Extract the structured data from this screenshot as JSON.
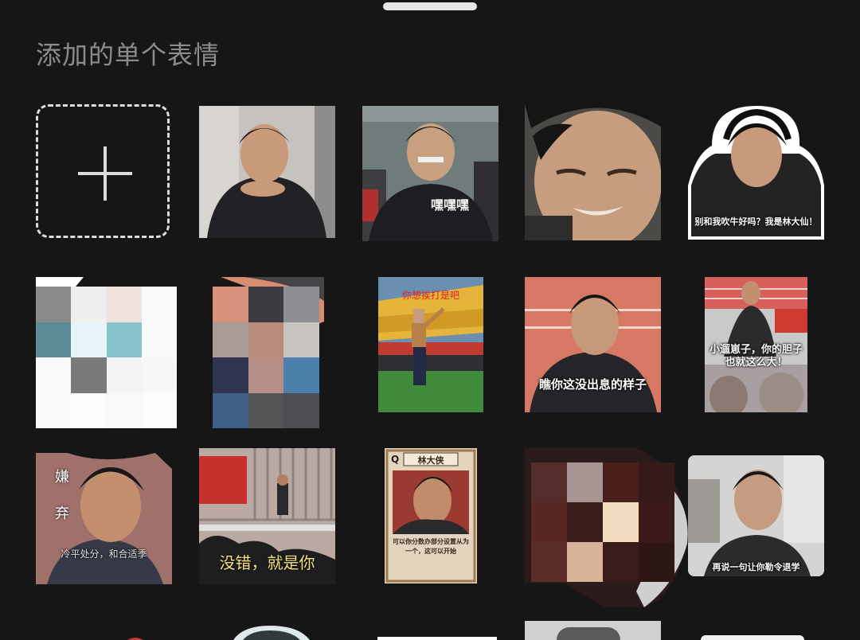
{
  "panel": {
    "section_title": "添加的单个表情"
  },
  "add_tile": {
    "icon": "plus-icon"
  },
  "stickers": {
    "s5_caption": "别和我吹牛好吗？我是林大仙！",
    "s9_caption": "你想挨打是吧",
    "s10_caption": "瞧你这没出息的样子",
    "s11_caption": "小遛崽子，你的胆子也就这么大！",
    "s12_side": "嫌弃",
    "s12_caption": "冷平处分，和合适季",
    "s13_caption": "没错，就是你",
    "s14_banner": "林大侠",
    "s14_caption": "可以你分数办部分设置从为一个，这可以开始",
    "s16_caption": "再说一句让你勒令退学"
  },
  "colors": {
    "background": "#161616",
    "title_text": "#8c8c8c",
    "add_tile_border": "#dcdcdc",
    "handle": "#e6e6e6"
  }
}
